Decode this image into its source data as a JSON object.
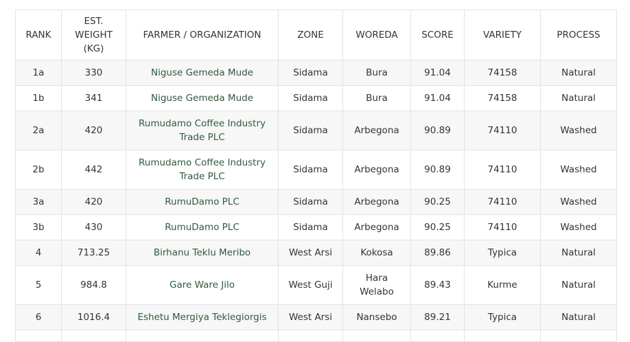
{
  "table": {
    "headers": [
      {
        "key": "rank",
        "label": "RANK"
      },
      {
        "key": "weight",
        "label": "EST. WEIGHT (kg)"
      },
      {
        "key": "farmer",
        "label": "FARMER / ORGANIZATION"
      },
      {
        "key": "zone",
        "label": "ZONE"
      },
      {
        "key": "woreda",
        "label": "WOREDA"
      },
      {
        "key": "score",
        "label": "SCORE"
      },
      {
        "key": "variety",
        "label": "VARIETY"
      },
      {
        "key": "process",
        "label": "PROCESS"
      }
    ],
    "rows": [
      {
        "rank": "1a",
        "weight": "330",
        "farmer": "Niguse Gemeda Mude",
        "zone": "Sidama",
        "woreda": "Bura",
        "score": "91.04",
        "variety": "74158",
        "process": "Natural"
      },
      {
        "rank": "1b",
        "weight": "341",
        "farmer": "Niguse Gemeda Mude",
        "zone": "Sidama",
        "woreda": "Bura",
        "score": "91.04",
        "variety": "74158",
        "process": "Natural"
      },
      {
        "rank": "2a",
        "weight": "420",
        "farmer": "Rumudamo Coffee Industry Trade PLC",
        "zone": "Sidama",
        "woreda": "Arbegona",
        "score": "90.89",
        "variety": "74110",
        "process": "Washed"
      },
      {
        "rank": "2b",
        "weight": "442",
        "farmer": "Rumudamo Coffee Industry Trade PLC",
        "zone": "Sidama",
        "woreda": "Arbegona",
        "score": "90.89",
        "variety": "74110",
        "process": "Washed"
      },
      {
        "rank": "3a",
        "weight": "420",
        "farmer": "RumuDamo PLC",
        "zone": "Sidama",
        "woreda": "Arbegona",
        "score": "90.25",
        "variety": "74110",
        "process": "Washed"
      },
      {
        "rank": "3b",
        "weight": "430",
        "farmer": "RumuDamo PLC",
        "zone": "Sidama",
        "woreda": "Arbegona",
        "score": "90.25",
        "variety": "74110",
        "process": "Washed"
      },
      {
        "rank": "4",
        "weight": "713.25",
        "farmer": "Birhanu Teklu Meribo",
        "zone": "West Arsi",
        "woreda": "Kokosa",
        "score": "89.86",
        "variety": "Typica",
        "process": "Natural"
      },
      {
        "rank": "5",
        "weight": "984.8",
        "farmer": "Gare Ware Jilo",
        "zone": "West Guji",
        "woreda": "Hara Welabo",
        "score": "89.43",
        "variety": "Kurme",
        "process": "Natural"
      },
      {
        "rank": "6",
        "weight": "1016.4",
        "farmer": "Eshetu Mergiya Teklegiorgis",
        "zone": "West Arsi",
        "woreda": "Nansebo",
        "score": "89.21",
        "variety": "Typica",
        "process": "Natural"
      },
      {
        "rank": "",
        "weight": "",
        "farmer": "",
        "zone": "",
        "woreda": "",
        "score": "",
        "variety": "",
        "process": ""
      }
    ]
  },
  "colors": {
    "link_text": "#2e5a3c",
    "row_stripe": "#f7f7f7",
    "border": "#e3e3e3"
  }
}
